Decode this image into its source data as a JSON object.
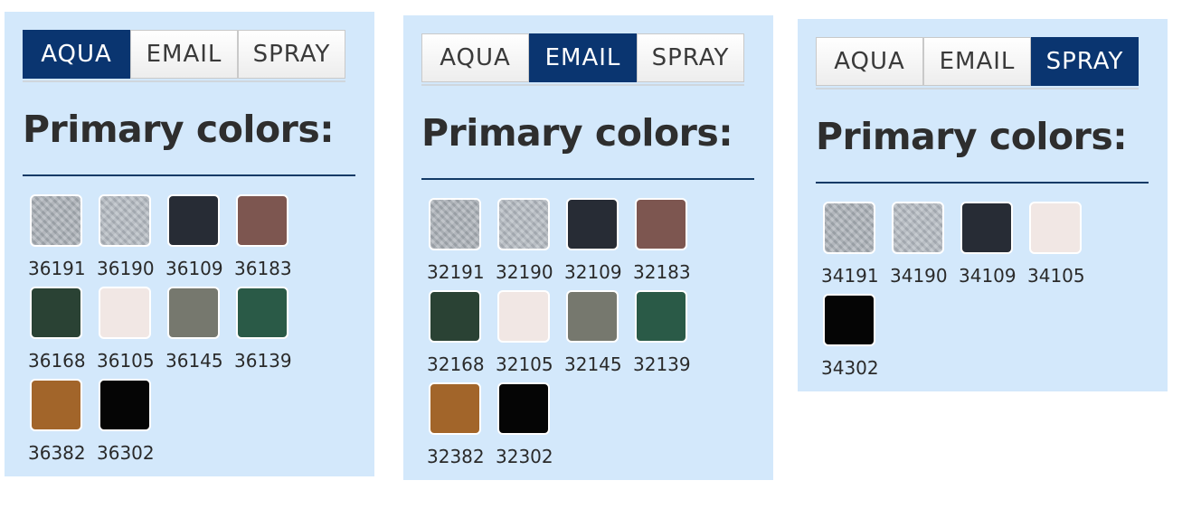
{
  "panels": [
    {
      "tabs": [
        "AQUA",
        "EMAIL",
        "SPRAY"
      ],
      "active_tab": 0,
      "title": "Primary colors:",
      "swatches": [
        {
          "code": "36191",
          "color": "#a7adb4",
          "textured": true
        },
        {
          "code": "36190",
          "color": "#b1b7be",
          "textured": true
        },
        {
          "code": "36109",
          "color": "#272c35",
          "textured": false
        },
        {
          "code": "36183",
          "color": "#7d5650",
          "textured": false
        },
        {
          "code": "36168",
          "color": "#2a4234",
          "textured": false
        },
        {
          "code": "36105",
          "color": "#f1e7e4",
          "textured": false
        },
        {
          "code": "36145",
          "color": "#76786e",
          "textured": false
        },
        {
          "code": "36139",
          "color": "#2a5a47",
          "textured": false
        },
        {
          "code": "36382",
          "color": "#a2652a",
          "textured": false
        },
        {
          "code": "36302",
          "color": "#050505",
          "textured": false
        }
      ]
    },
    {
      "tabs": [
        "AQUA",
        "EMAIL",
        "SPRAY"
      ],
      "active_tab": 1,
      "title": "Primary colors:",
      "swatches": [
        {
          "code": "32191",
          "color": "#a7adb4",
          "textured": true
        },
        {
          "code": "32190",
          "color": "#b1b7be",
          "textured": true
        },
        {
          "code": "32109",
          "color": "#272c35",
          "textured": false
        },
        {
          "code": "32183",
          "color": "#7d5650",
          "textured": false
        },
        {
          "code": "32168",
          "color": "#2a4234",
          "textured": false
        },
        {
          "code": "32105",
          "color": "#f1e7e4",
          "textured": false
        },
        {
          "code": "32145",
          "color": "#76786e",
          "textured": false
        },
        {
          "code": "32139",
          "color": "#2a5a47",
          "textured": false
        },
        {
          "code": "32382",
          "color": "#a2652a",
          "textured": false
        },
        {
          "code": "32302",
          "color": "#050505",
          "textured": false
        }
      ]
    },
    {
      "tabs": [
        "AQUA",
        "EMAIL",
        "SPRAY"
      ],
      "active_tab": 2,
      "title": "Primary colors:",
      "swatches": [
        {
          "code": "34191",
          "color": "#a7adb4",
          "textured": true
        },
        {
          "code": "34190",
          "color": "#b1b7be",
          "textured": true
        },
        {
          "code": "34109",
          "color": "#272c35",
          "textured": false
        },
        {
          "code": "34105",
          "color": "#f1e7e4",
          "textured": false
        },
        {
          "code": "34302",
          "color": "#050505",
          "textured": false
        }
      ]
    }
  ],
  "colors": {
    "panel_bg": "#d3e8fb",
    "active_tab_bg": "#0a3570",
    "rule": "#123a66"
  }
}
